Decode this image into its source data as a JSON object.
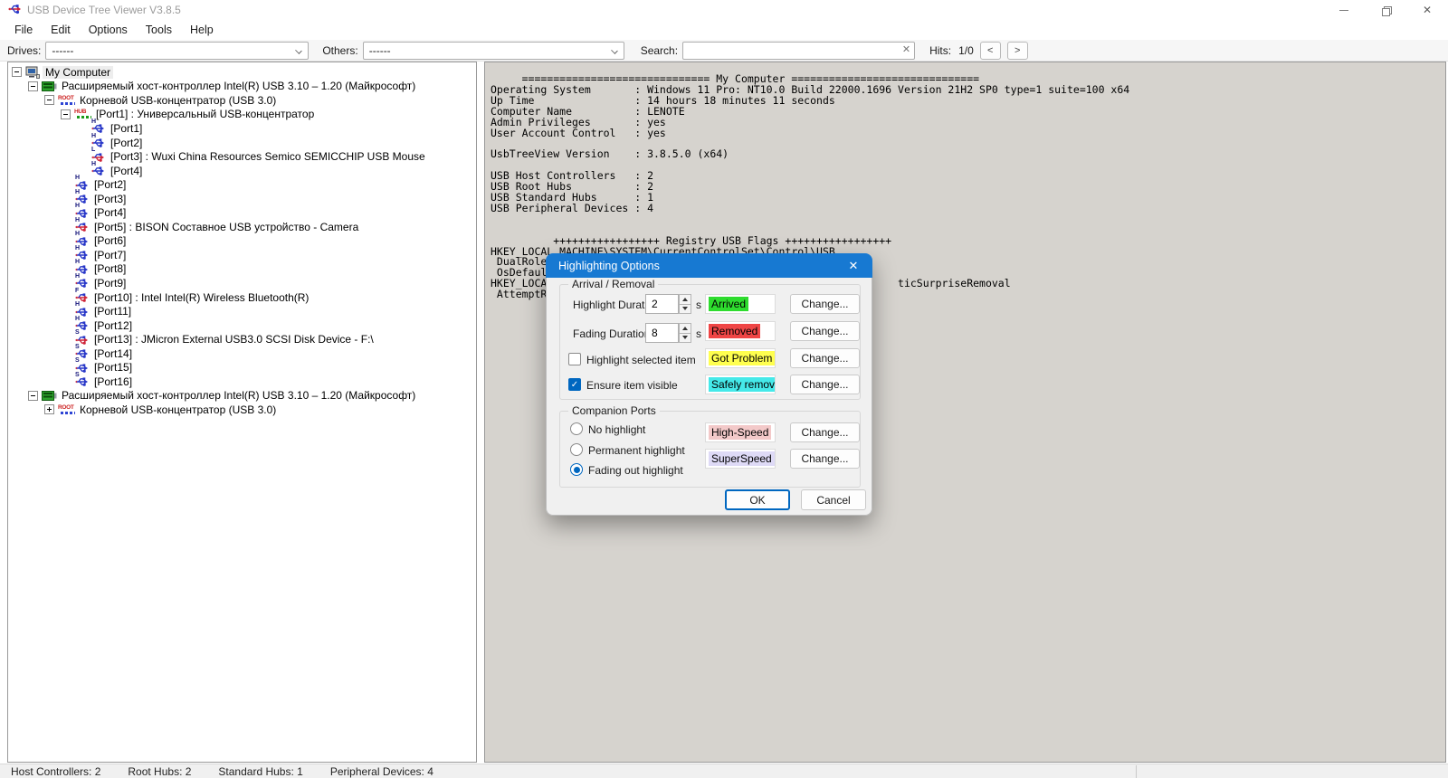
{
  "window": {
    "title": "USB Device Tree Viewer V3.8.5"
  },
  "menu": {
    "items": [
      "File",
      "Edit",
      "Options",
      "Tools",
      "Help"
    ]
  },
  "toolbar": {
    "drives_label": "Drives:",
    "drives_value": "------",
    "others_label": "Others:",
    "others_value": "------",
    "search_label": "Search:",
    "search_value": "",
    "clear_icon": "✕",
    "hits_label": "Hits:",
    "hits_value": "1/0",
    "prev_label": "<",
    "next_label": ">"
  },
  "tree": {
    "items": [
      {
        "label": "My Computer",
        "level": 0,
        "icon": "computer",
        "expand": "minus",
        "selected": true
      },
      {
        "label": "Расширяемый хост-контроллер Intel(R) USB 3.10 – 1.20 (Майкрософт)",
        "level": 1,
        "icon": "controller",
        "expand": "minus"
      },
      {
        "label": "Корневой USB-концентратор (USB 3.0)",
        "level": 2,
        "icon": "root",
        "expand": "minus"
      },
      {
        "label": "[Port1] : Универсальный USB-концентратор",
        "level": 3,
        "icon": "hub",
        "expand": "minus"
      },
      {
        "label": "[Port1]",
        "level": 4,
        "icon": "port",
        "letter": "H",
        "connected": false
      },
      {
        "label": "[Port2]",
        "level": 4,
        "icon": "port",
        "letter": "H",
        "connected": false
      },
      {
        "label": "[Port3] : Wuxi China Resources Semico SEMICCHIP USB Mouse",
        "level": 4,
        "icon": "port",
        "letter": "L",
        "connected": true
      },
      {
        "label": "[Port4]",
        "level": 4,
        "icon": "port",
        "letter": "H",
        "connected": false
      },
      {
        "label": "[Port2]",
        "level": 3,
        "icon": "port",
        "letter": "H",
        "connected": false
      },
      {
        "label": "[Port3]",
        "level": 3,
        "icon": "port",
        "letter": "H",
        "connected": false
      },
      {
        "label": "[Port4]",
        "level": 3,
        "icon": "port",
        "letter": "H",
        "connected": false
      },
      {
        "label": "[Port5] : BISON Составное USB устройство - Camera",
        "level": 3,
        "icon": "port",
        "letter": "H",
        "connected": true
      },
      {
        "label": "[Port6]",
        "level": 3,
        "icon": "port",
        "letter": "H",
        "connected": false
      },
      {
        "label": "[Port7]",
        "level": 3,
        "icon": "port",
        "letter": "H",
        "connected": false
      },
      {
        "label": "[Port8]",
        "level": 3,
        "icon": "port",
        "letter": "H",
        "connected": false
      },
      {
        "label": "[Port9]",
        "level": 3,
        "icon": "port",
        "letter": "H",
        "connected": false
      },
      {
        "label": "[Port10] : Intel Intel(R) Wireless Bluetooth(R)",
        "level": 3,
        "icon": "port",
        "letter": "F",
        "connected": true
      },
      {
        "label": "[Port11]",
        "level": 3,
        "icon": "port",
        "letter": "H",
        "connected": false
      },
      {
        "label": "[Port12]",
        "level": 3,
        "icon": "port",
        "letter": "H",
        "connected": false
      },
      {
        "label": "[Port13] : JMicron External USB3.0 SCSI Disk Device - F:\\",
        "level": 3,
        "icon": "port",
        "letter": "S",
        "connected": true
      },
      {
        "label": "[Port14]",
        "level": 3,
        "icon": "port",
        "letter": "S",
        "connected": false
      },
      {
        "label": "[Port15]",
        "level": 3,
        "icon": "port",
        "letter": "S",
        "connected": false
      },
      {
        "label": "[Port16]",
        "level": 3,
        "icon": "port",
        "letter": "S",
        "connected": false
      },
      {
        "label": "Расширяемый хост-контроллер Intel(R) USB 3.10 – 1.20 (Майкрософт)",
        "level": 1,
        "icon": "controller",
        "expand": "minus"
      },
      {
        "label": "Корневой USB-концентратор (USB 3.0)",
        "level": 2,
        "icon": "root",
        "expand": "plus"
      }
    ]
  },
  "info": {
    "text": "     ============================== My Computer ==============================\nOperating System       : Windows 11 Pro: NT10.0 Build 22000.1696 Version 21H2 SP0 type=1 suite=100 x64\nUp Time                : 14 hours 18 minutes 11 seconds\nComputer Name          : LENOTE\nAdmin Privileges       : yes\nUser Account Control   : yes\n\nUsbTreeView Version    : 3.8.5.0 (x64)\n\nUSB Host Controllers   : 2\nUSB Root Hubs          : 2\nUSB Standard Hubs      : 1\nUSB Peripheral Devices : 4\n\n\n          +++++++++++++++++ Registry USB Flags +++++++++++++++++\nHKEY_LOCAL_MACHINE\\SYSTEM\\CurrentControlSet\\Control\\USB\n DualRoleF\n OsDefault\nHKEY_LOCAL                                                       ticSurpriseRemoval\n AttemptRe"
  },
  "dialog": {
    "title": "Highlighting Options",
    "close_icon": "✕",
    "arrival_group": "Arrival / Removal",
    "highlight_duration_label": "Highlight Duration:",
    "highlight_duration_value": "2",
    "fading_duration_label": "Fading Duration:",
    "fading_duration_value": "8",
    "seconds_unit": "s",
    "highlight_selected_label": "Highlight selected item",
    "ensure_visible_label": "Ensure item visible",
    "check_glyph": "✓",
    "samples": {
      "arrived": {
        "label": "Arrived",
        "color": "#2edc2e"
      },
      "removed": {
        "label": "Removed",
        "color": "#ef4545"
      },
      "got_problem": {
        "label": "Got Problem",
        "color": "#ffff4f"
      },
      "safely_removed": {
        "label": "Safely removed",
        "color": "#45e9e9"
      },
      "high_speed": {
        "label": "High-Speed",
        "color": "#f3c9c9"
      },
      "superspeed": {
        "label": "SuperSpeed",
        "color": "#dedaf6"
      }
    },
    "change_label": "Change...",
    "companion_group": "Companion Ports",
    "radio_no_highlight": "No highlight",
    "radio_permanent": "Permanent highlight",
    "radio_fading": "Fading out highlight",
    "ok_label": "OK",
    "cancel_label": "Cancel",
    "accent_color": "#0067c0"
  },
  "statusbar": {
    "items": [
      "Host Controllers: 2",
      "Root Hubs: 2",
      "Standard Hubs: 1",
      "Peripheral Devices: 4"
    ]
  }
}
